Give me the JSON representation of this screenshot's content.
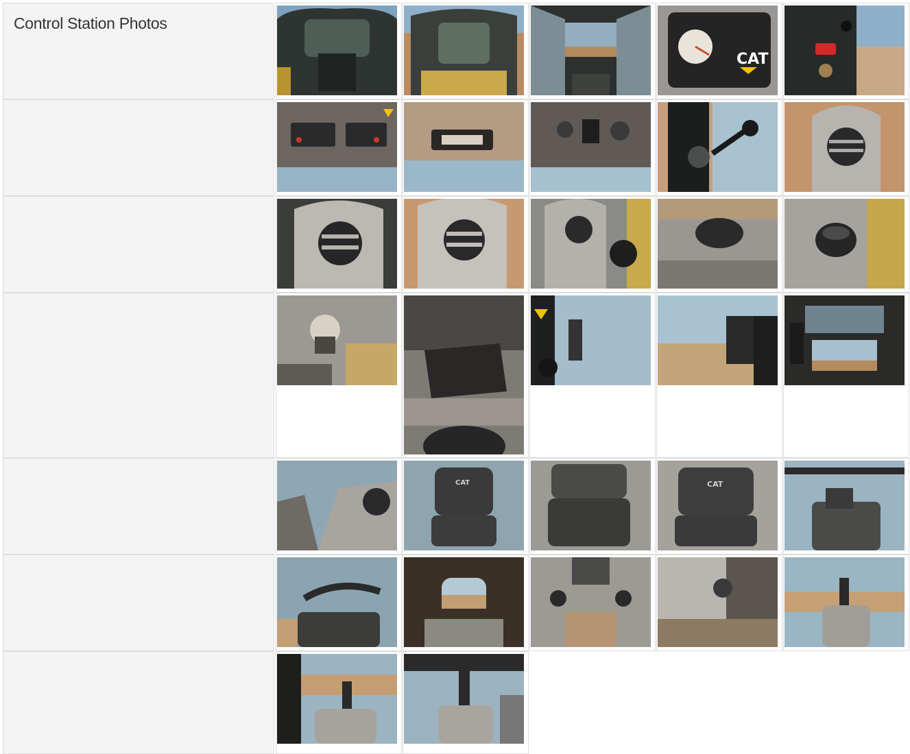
{
  "section": {
    "title": "Control Station Photos"
  },
  "rows": [
    {
      "photos": [
        "cab-interior-front",
        "cab-interior-door-open",
        "cab-window-view",
        "gauge-panel-cat",
        "ignition-panel"
      ]
    },
    {
      "photos": [
        "overhead-switch-panel",
        "overhead-dome-light",
        "overhead-climate-controls",
        "left-joystick-cage",
        "air-vent-right"
      ]
    },
    {
      "photos": [
        "air-vent-left",
        "air-vent-closeup",
        "air-vent-cupholder",
        "air-vent-side",
        "cupholder-closeup"
      ]
    },
    {
      "photos": [
        "knob-floor-plate",
        "bracket-closeup",
        "door-latch-left",
        "door-latch-right",
        "cab-rear-view-window"
      ]
    },
    {
      "photos": [
        "seat-armrest-vent",
        "cat-seat-front",
        "seat-closeup",
        "cat-seat-side",
        "seat-bar-lowered"
      ]
    },
    {
      "photos": [
        "seat-bar-cage",
        "rear-window-view",
        "controls-overhead-view",
        "floor-cupholder",
        "right-joystick-window"
      ]
    },
    {
      "photos": [
        "left-joystick",
        "right-joystick"
      ]
    }
  ]
}
